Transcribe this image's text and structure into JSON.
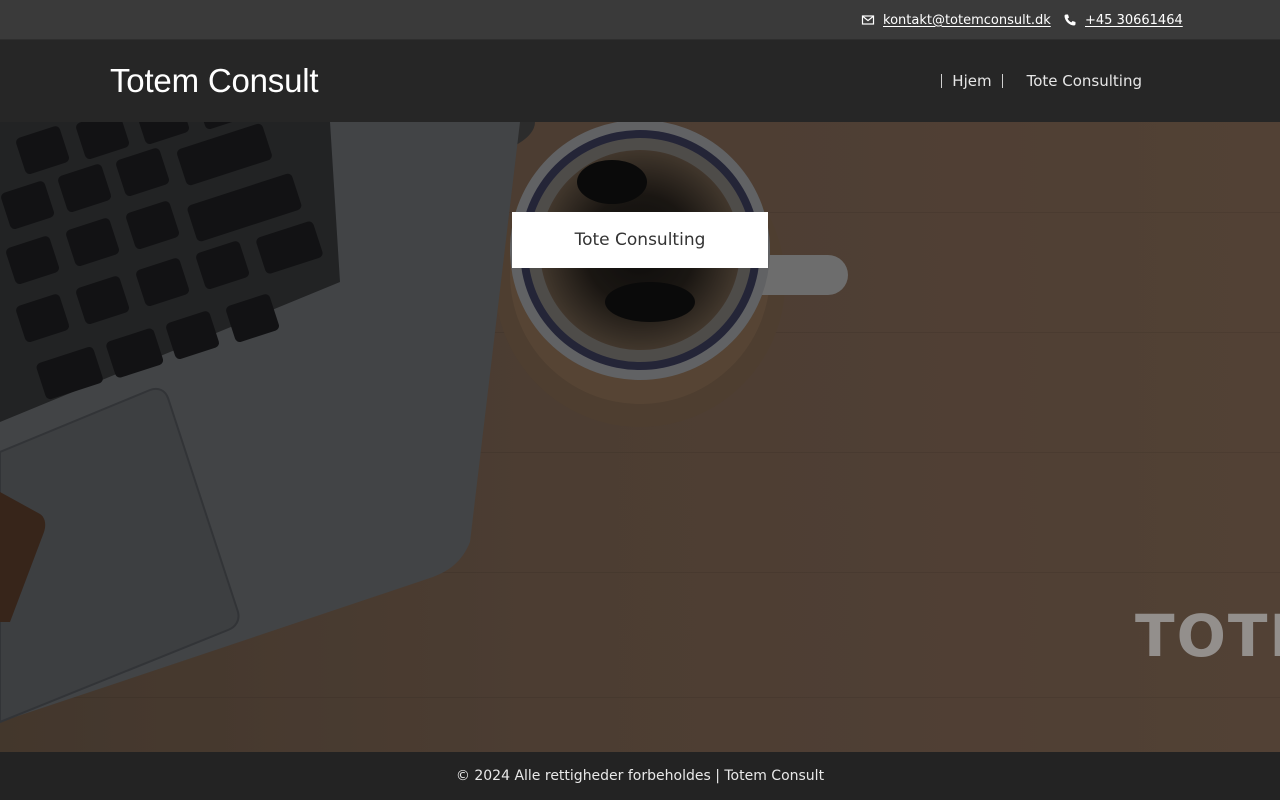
{
  "topbar": {
    "email": {
      "icon": "envelope-icon",
      "text": "kontakt@totemconsult.dk"
    },
    "phone": {
      "icon": "phone-icon",
      "text": "+45 30661464"
    }
  },
  "header": {
    "brand": "Totem Consult",
    "nav": [
      {
        "label": "Hjem"
      },
      {
        "label": "Tote Consulting"
      }
    ]
  },
  "hero": {
    "button_label": "Tote Consulting",
    "watermark_text": "TOTE",
    "colors": {
      "wood": "#6b5443",
      "laptop": "#5a5d60",
      "keys": "#151515"
    }
  },
  "footer": {
    "text": "© 2024 Alle rettigheder forbeholdes | Totem Consult"
  }
}
